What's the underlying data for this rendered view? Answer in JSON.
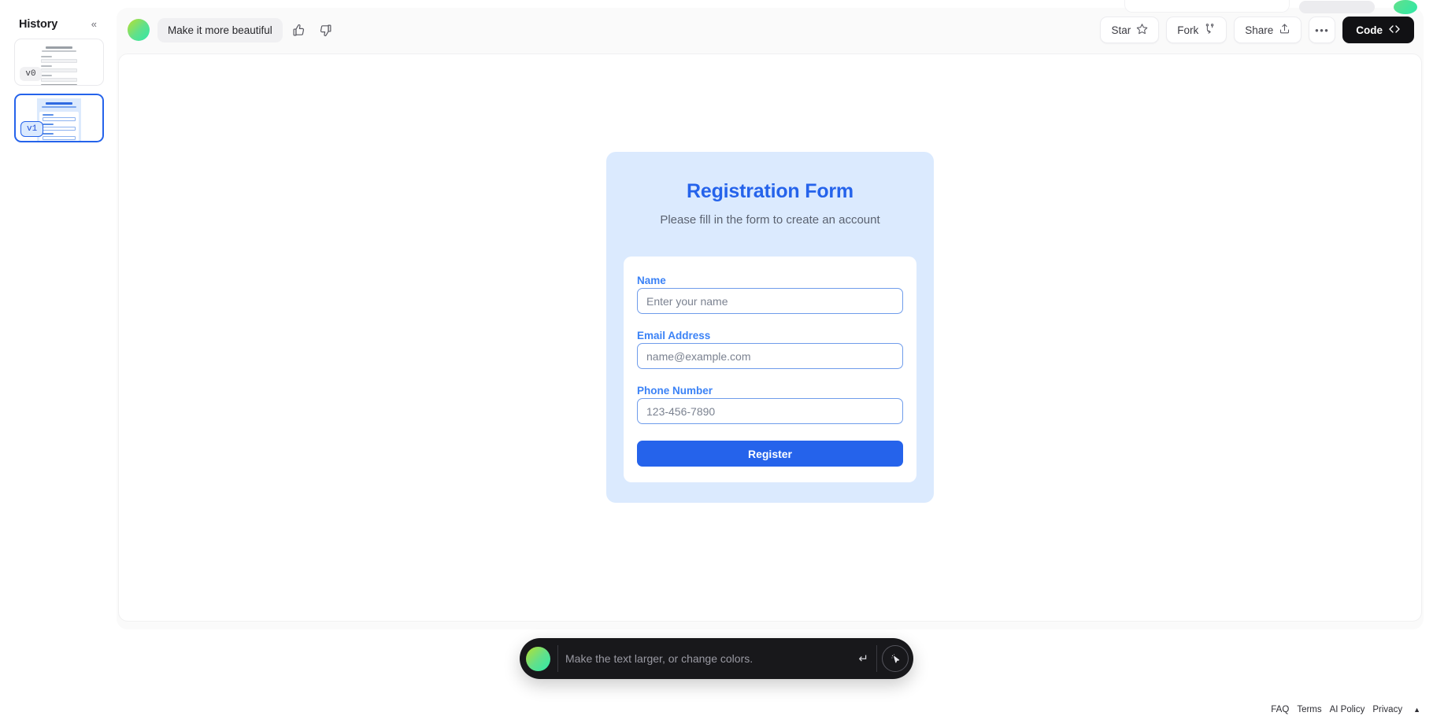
{
  "sidebar": {
    "title": "History",
    "collapse_icon": "chevrons-left-icon",
    "versions": [
      {
        "label": "v0",
        "active": false
      },
      {
        "label": "v1",
        "active": true
      }
    ]
  },
  "toolbar": {
    "avatar": "ai-orb-avatar",
    "prompt_chip": "Make it more beautiful",
    "thumbs_up_icon": "thumbs-up-icon",
    "thumbs_down_icon": "thumbs-down-icon",
    "star_label": "Star",
    "star_icon": "star-icon",
    "fork_label": "Fork",
    "fork_icon": "fork-icon",
    "share_label": "Share",
    "share_icon": "share-upload-icon",
    "more_label": "•••",
    "more_icon": "ellipsis-icon",
    "code_label": "Code",
    "code_icon": "code-brackets-icon"
  },
  "form": {
    "heading": "Registration Form",
    "subheading": "Please fill in the form to create an account",
    "fields": [
      {
        "label": "Name",
        "placeholder": "Enter your name",
        "value": ""
      },
      {
        "label": "Email Address",
        "placeholder": "name@example.com",
        "value": ""
      },
      {
        "label": "Phone Number",
        "placeholder": "123-456-7890",
        "value": ""
      }
    ],
    "submit_label": "Register"
  },
  "composer": {
    "avatar": "ai-orb-avatar",
    "placeholder": "Make the text larger, or change colors.",
    "value": "",
    "enter_icon": "enter-return-icon",
    "select_icon": "select-cursor-icon"
  },
  "footer": {
    "links": [
      "FAQ",
      "Terms",
      "AI Policy",
      "Privacy"
    ],
    "caret_icon": "caret-up-icon"
  },
  "colors": {
    "accent_blue": "#2563eb",
    "label_blue": "#3b82f6",
    "form_bg": "#dbeafe",
    "dark": "#18181b"
  }
}
